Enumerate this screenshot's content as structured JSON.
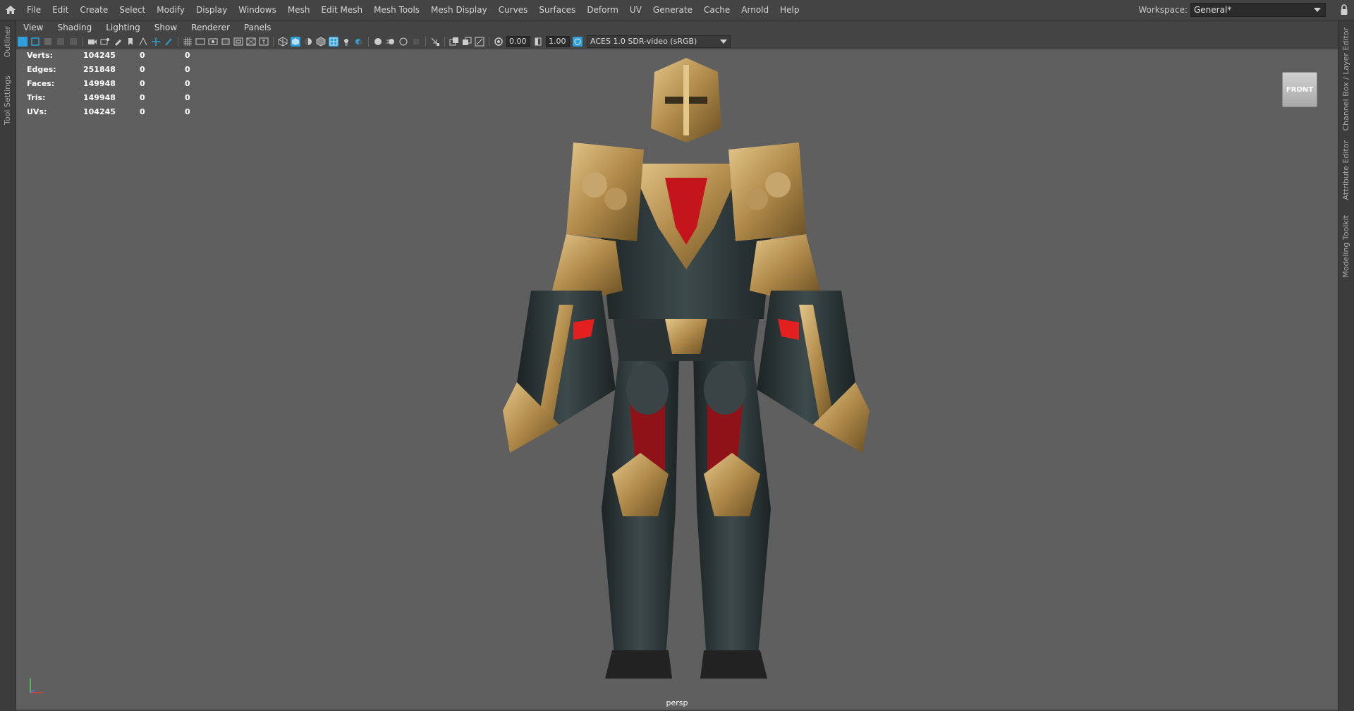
{
  "menubar": {
    "items": [
      "File",
      "Edit",
      "Create",
      "Select",
      "Modify",
      "Display",
      "Windows",
      "Mesh",
      "Edit Mesh",
      "Mesh Tools",
      "Mesh Display",
      "Curves",
      "Surfaces",
      "Deform",
      "UV",
      "Generate",
      "Cache",
      "Arnold",
      "Help"
    ],
    "workspace_label": "Workspace:",
    "workspace_value": "General*"
  },
  "left_tabs": [
    "Outliner",
    "Tool Settings"
  ],
  "right_tabs": [
    "Channel Box / Layer Editor",
    "Attribute Editor",
    "Modeling Toolkit"
  ],
  "panel_menu": [
    "View",
    "Shading",
    "Lighting",
    "Show",
    "Renderer",
    "Panels"
  ],
  "toolbar": {
    "exposure": "0.00",
    "gamma": "1.00",
    "color_space": "ACES 1.0 SDR-video (sRGB)"
  },
  "hud": {
    "rows": [
      {
        "label": "Verts:",
        "v1": "104245",
        "v2": "0",
        "v3": "0"
      },
      {
        "label": "Edges:",
        "v1": "251848",
        "v2": "0",
        "v3": "0"
      },
      {
        "label": "Faces:",
        "v1": "149948",
        "v2": "0",
        "v3": "0"
      },
      {
        "label": "Tris:",
        "v1": "149948",
        "v2": "0",
        "v3": "0"
      },
      {
        "label": "UVs:",
        "v1": "104245",
        "v2": "0",
        "v3": "0"
      }
    ]
  },
  "viewcube_label": "FRONT",
  "camera_label": "persp",
  "colors": {
    "viewport_bg": "#5f5f5f",
    "armor_gold": "#b8955a",
    "armor_dark": "#2b3436",
    "accent_red": "#c4141c",
    "accent_blue": "#2e9fd8"
  }
}
